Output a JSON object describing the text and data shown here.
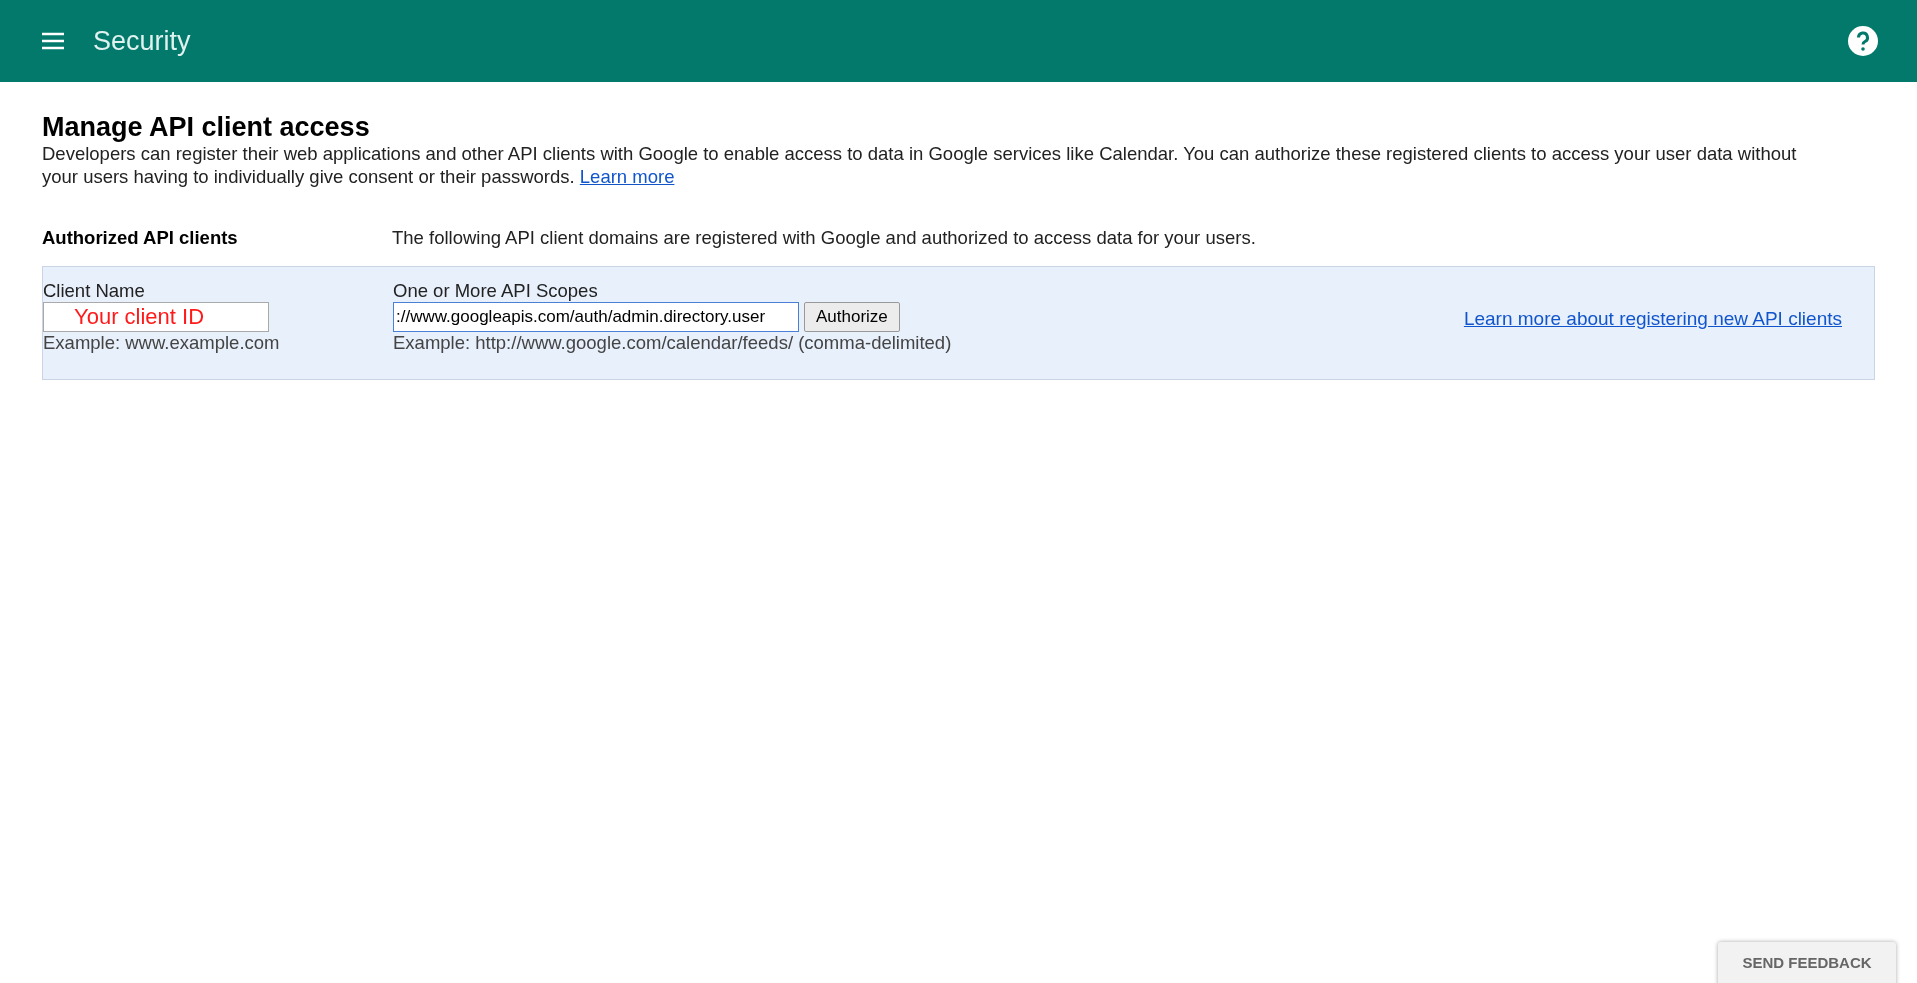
{
  "app_bar": {
    "title": "Security"
  },
  "page": {
    "heading": "Manage API client access",
    "description": "Developers can register their web applications and other API clients with Google to enable access to data in Google services like Calendar. You can authorize these registered clients to access your user data without your users having to individually give consent or their passwords.",
    "learn_more_link": "Learn more"
  },
  "authorized_clients": {
    "label": "Authorized API clients",
    "description": "The following API client domains are registered with Google and authorized to access data for your users."
  },
  "form": {
    "client_name_label": "Client Name",
    "client_name_value": "Your client ID",
    "client_name_example": "Example: www.example.com",
    "scopes_label": "One or More API Scopes",
    "scopes_value": "://www.googleapis.com/auth/admin.directory.user",
    "scopes_example": "Example: http://www.google.com/calendar/feeds/ (comma-delimited)",
    "authorize_button": "Authorize",
    "register_link": "Learn more about registering new API clients"
  },
  "feedback_button": "SEND FEEDBACK"
}
